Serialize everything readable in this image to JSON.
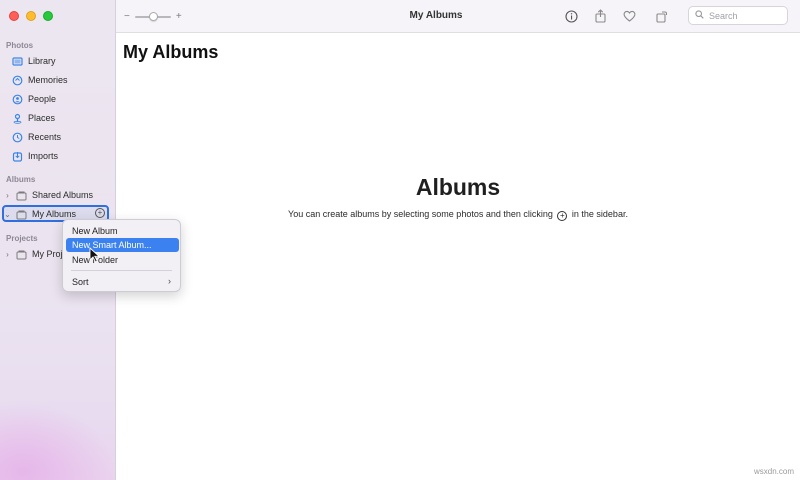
{
  "sidebar": {
    "sections": {
      "photos": "Photos",
      "albums": "Albums",
      "projects": "Projects"
    },
    "photos_items": [
      {
        "label": "Library",
        "icon": "library-icon"
      },
      {
        "label": "Memories",
        "icon": "memories-icon"
      },
      {
        "label": "People",
        "icon": "people-icon"
      },
      {
        "label": "Places",
        "icon": "places-icon"
      },
      {
        "label": "Recents",
        "icon": "recents-icon"
      },
      {
        "label": "Imports",
        "icon": "imports-icon"
      }
    ],
    "albums_items": [
      {
        "label": "Shared Albums",
        "icon": "shared-albums-icon"
      },
      {
        "label": "My Albums",
        "icon": "folder-icon"
      }
    ],
    "projects_items": [
      {
        "label": "My Proje",
        "icon": "folder-icon"
      }
    ]
  },
  "toolbar": {
    "zoom_minus": "−",
    "zoom_plus": "+",
    "title": "My Albums",
    "search_placeholder": "Search"
  },
  "main": {
    "page_title": "My Albums",
    "empty_title": "Albums",
    "empty_text_before": "You can create albums by selecting some photos and then clicking",
    "empty_text_after": "in the sidebar."
  },
  "context_menu": {
    "items": [
      "New Album",
      "New Smart Album...",
      "New Folder",
      "Sort"
    ],
    "highlighted": "New Smart Album..."
  },
  "watermark": "wsxdn.com",
  "colors": {
    "accent": "#3b82f0",
    "selection_border": "#2f6fde"
  }
}
